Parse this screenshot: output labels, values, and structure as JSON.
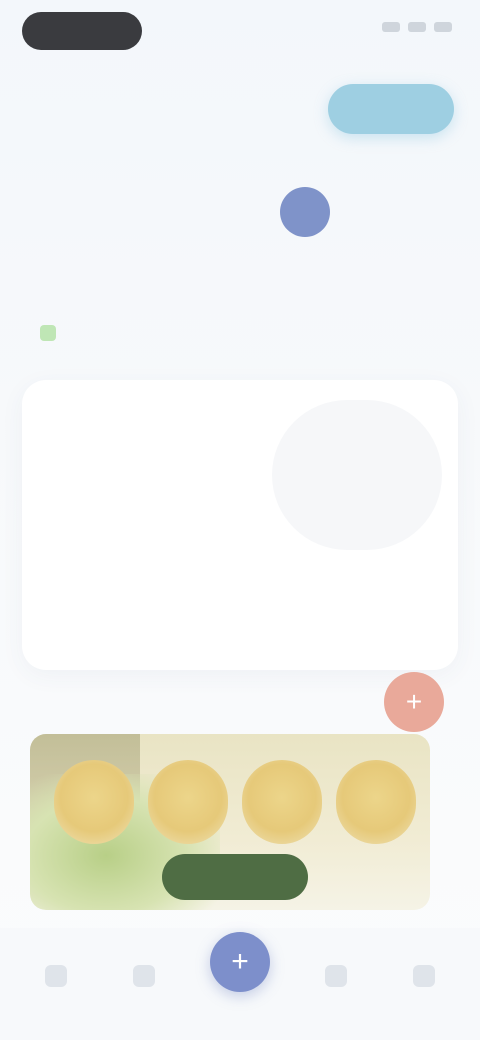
{
  "header": {
    "title": "",
    "cta_label": ""
  },
  "week": {
    "days": [
      "",
      "",
      "",
      "",
      "",
      "",
      ""
    ],
    "active_index": 4
  },
  "section": {
    "label": ""
  },
  "goal": {
    "title": "",
    "edit_label": ""
  },
  "summary": {
    "stats": [
      {
        "label": "",
        "value": ""
      },
      {
        "label": "",
        "value": ""
      }
    ],
    "ring_value": "",
    "ring_label": "",
    "macros": [
      {
        "value": "",
        "name": ""
      },
      {
        "value": "",
        "name": ""
      },
      {
        "value": "",
        "name": ""
      }
    ]
  },
  "promo": {
    "title": "",
    "cta_label": "",
    "fab_icon": "plus-icon"
  },
  "nav": {
    "items": [
      "home-icon",
      "stats-icon",
      "add-icon",
      "recipes-icon",
      "profile-icon"
    ],
    "center_glyph": "+"
  },
  "colors": {
    "accent": "#7f93c9",
    "header_cta": "#9ecfe2",
    "promo_cta": "#4f6d44",
    "fab": "#e9a99a"
  }
}
